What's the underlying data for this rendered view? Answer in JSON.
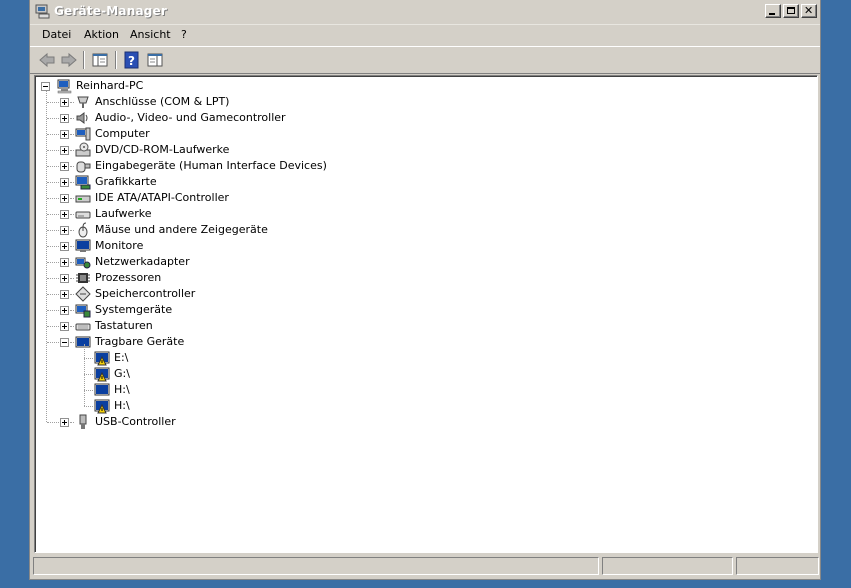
{
  "window": {
    "title": "Geräte-Manager"
  },
  "menu": [
    "Datei",
    "Aktion",
    "Ansicht",
    "?"
  ],
  "toolbar": {
    "buttons": [
      "back-icon",
      "forward-icon",
      "show-hide-console-tree-icon",
      "help-icon",
      "properties-icon"
    ]
  },
  "tree": {
    "root": "Reinhard-PC",
    "categories": [
      "Anschlüsse (COM & LPT)",
      "Audio-, Video- und Gamecontroller",
      "Computer",
      "DVD/CD-ROM-Laufwerke",
      "Eingabegeräte (Human Interface Devices)",
      "Grafikkarte",
      "IDE ATA/ATAPI-Controller",
      "Laufwerke",
      "Mäuse und andere Zeigegeräte",
      "Monitore",
      "Netzwerkadapter",
      "Prozessoren",
      "Speichercontroller",
      "Systemgeräte",
      "Tastaturen",
      "Tragbare Geräte",
      "USB-Controller"
    ],
    "portable_devices": [
      "E:\\",
      "G:\\",
      "H:\\",
      "H:\\"
    ]
  },
  "colors": {
    "desktop": "#3a6ea5",
    "window_face": "#d4d0c8",
    "warning": "#f6d20a"
  }
}
